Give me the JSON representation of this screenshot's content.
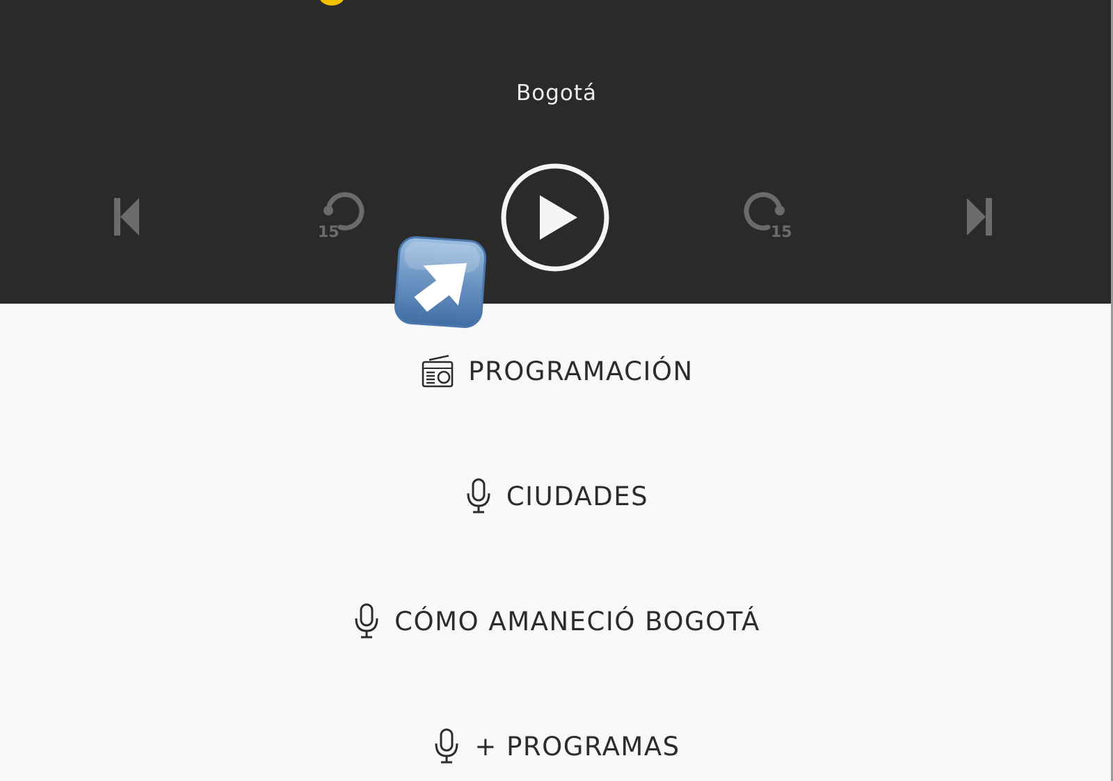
{
  "player": {
    "city": "Bogotá",
    "controls": {
      "previous": "skip-previous",
      "rewind_seconds": "15",
      "play": "play",
      "forward_seconds": "15",
      "next": "skip-next"
    }
  },
  "menu": {
    "items": [
      {
        "label": "PROGRAMACIÓN",
        "icon": "radio-icon"
      },
      {
        "label": "CIUDADES",
        "icon": "microphone-icon"
      },
      {
        "label": "CÓMO AMANECIÓ BOGOTÁ",
        "icon": "microphone-icon"
      },
      {
        "label": "+ PROGRAMAS",
        "icon": "microphone-icon"
      }
    ]
  },
  "colors": {
    "player_background": "#2a2a2a",
    "page_background": "#f8f8f8",
    "accent_yellow": "#f2c100",
    "disabled_control": "#6b6b6b",
    "menu_text": "#2c2c2c"
  }
}
